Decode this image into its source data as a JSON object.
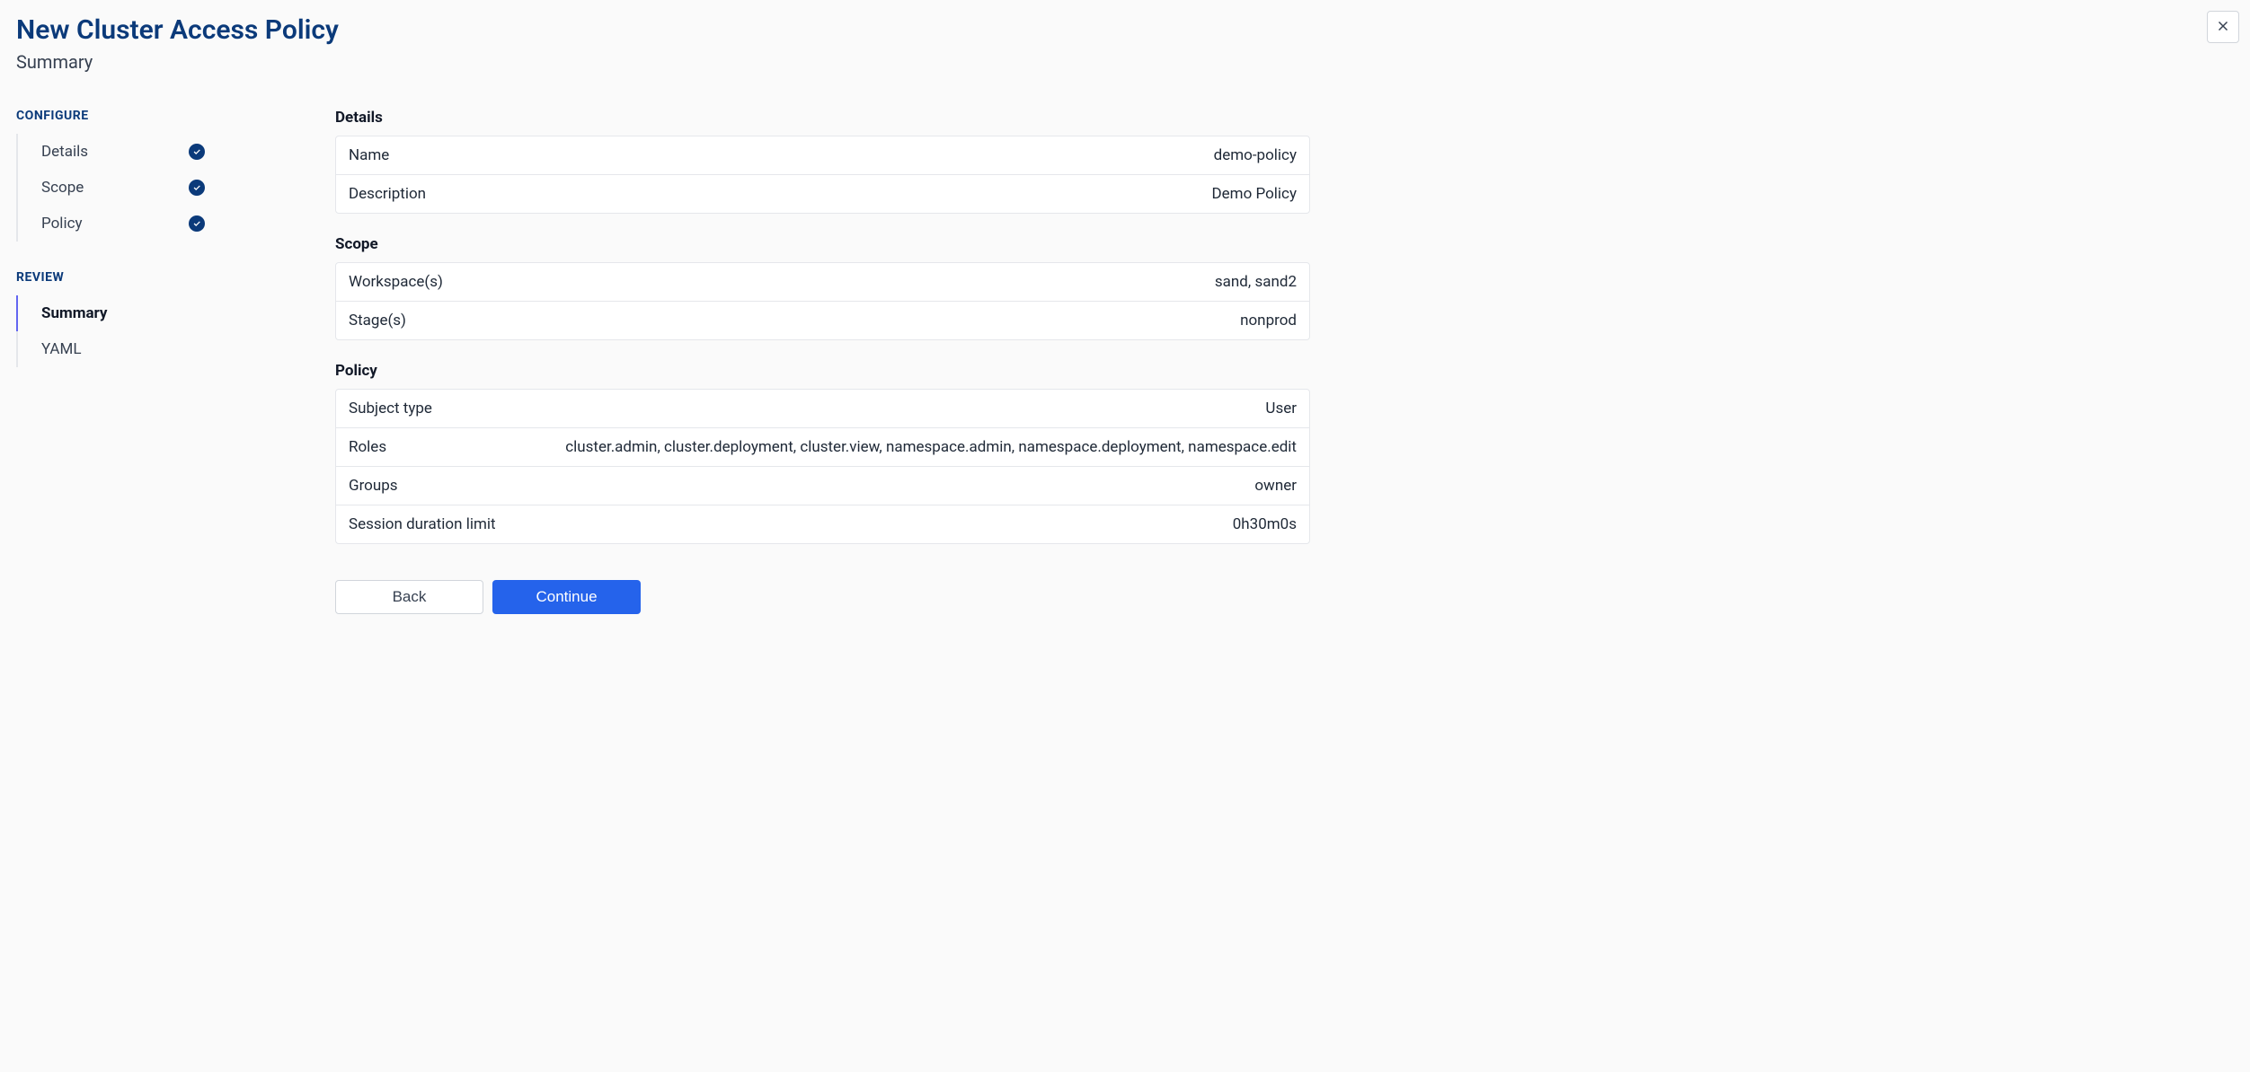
{
  "header": {
    "title": "New Cluster Access Policy",
    "subtitle": "Summary"
  },
  "sidebar": {
    "configure": {
      "title": "CONFIGURE",
      "items": [
        {
          "label": "Details",
          "completed": true
        },
        {
          "label": "Scope",
          "completed": true
        },
        {
          "label": "Policy",
          "completed": true
        }
      ]
    },
    "review": {
      "title": "REVIEW",
      "items": [
        {
          "label": "Summary",
          "active": true
        },
        {
          "label": "YAML"
        }
      ]
    }
  },
  "sections": {
    "details": {
      "title": "Details",
      "rows": [
        {
          "label": "Name",
          "value": "demo-policy"
        },
        {
          "label": "Description",
          "value": "Demo Policy"
        }
      ]
    },
    "scope": {
      "title": "Scope",
      "rows": [
        {
          "label": "Workspace(s)",
          "value": "sand, sand2"
        },
        {
          "label": "Stage(s)",
          "value": "nonprod"
        }
      ]
    },
    "policy": {
      "title": "Policy",
      "rows": [
        {
          "label": "Subject type",
          "value": "User"
        },
        {
          "label": "Roles",
          "value": "cluster.admin, cluster.deployment, cluster.view, namespace.admin, namespace.deployment, namespace.edit"
        },
        {
          "label": "Groups",
          "value": "owner"
        },
        {
          "label": "Session duration limit",
          "value": "0h30m0s"
        }
      ]
    }
  },
  "actions": {
    "back": "Back",
    "continue": "Continue"
  }
}
